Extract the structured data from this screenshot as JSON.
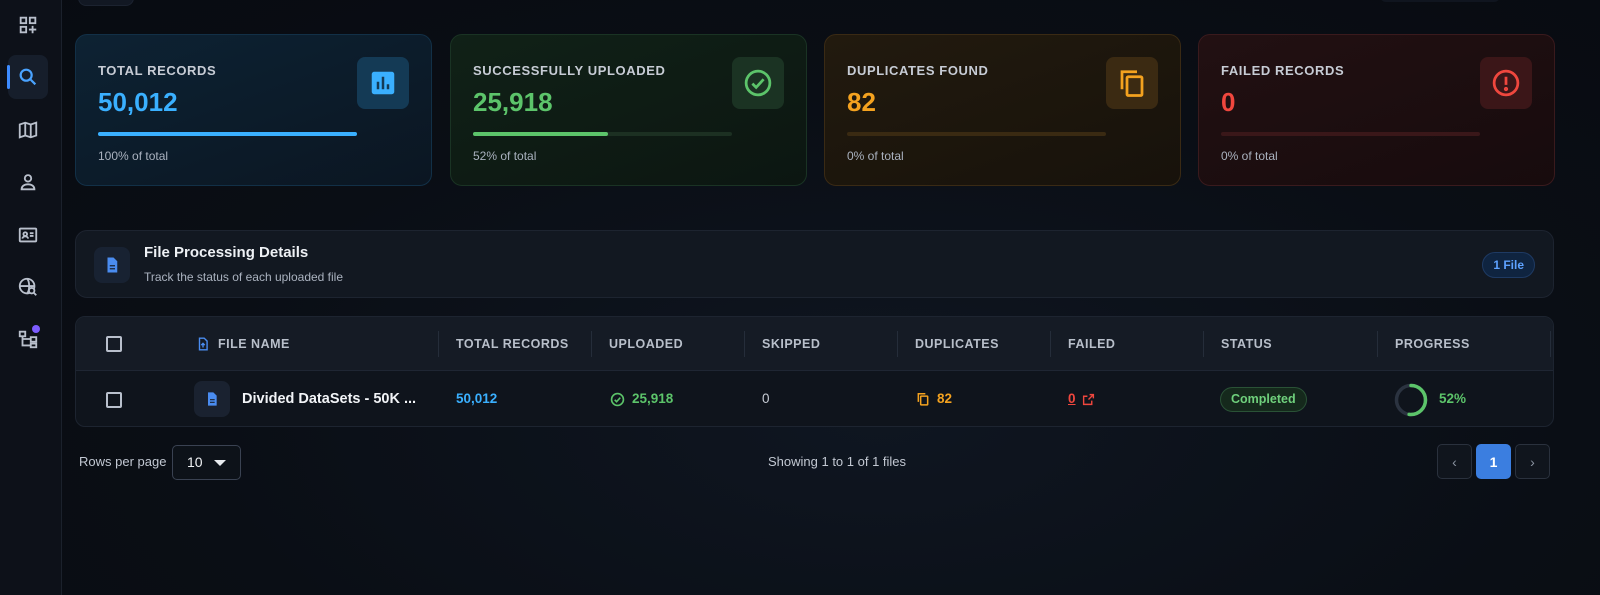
{
  "sidebar": {
    "items": [
      {
        "icon": "apps-add-icon",
        "active": false
      },
      {
        "icon": "search-icon",
        "active": true
      },
      {
        "icon": "map-icon",
        "active": false
      },
      {
        "icon": "user-icon",
        "active": false
      },
      {
        "icon": "id-card-icon",
        "active": false
      },
      {
        "icon": "globe-search-icon",
        "active": false
      },
      {
        "icon": "hierarchy-icon",
        "active": false,
        "badge": true
      }
    ]
  },
  "stats": {
    "total": {
      "label": "TOTAL RECORDS",
      "value": "50,012",
      "progress": 1.0,
      "sub": "100% of total",
      "icon": "bar-chart-icon",
      "color": "#3ab0ff"
    },
    "uploaded": {
      "label": "SUCCESSFULLY UPLOADED",
      "value": "25,918",
      "progress": 0.52,
      "sub": "52% of total",
      "icon": "check-circle-icon",
      "color": "#5cc46a"
    },
    "duplicates": {
      "label": "DUPLICATES FOUND",
      "value": "82",
      "progress": 0.0,
      "sub": "0% of total",
      "icon": "copy-icon",
      "color": "#f4a21f"
    },
    "failed": {
      "label": "FAILED RECORDS",
      "value": "0",
      "progress": 0.0,
      "sub": "0% of total",
      "icon": "alert-circle-icon",
      "color": "#f0473e"
    }
  },
  "section": {
    "title": "File Processing Details",
    "subtitle": "Track the status of each uploaded file",
    "count_badge": "1 File"
  },
  "table": {
    "columns": [
      "FILE NAME",
      "TOTAL RECORDS",
      "UPLOADED",
      "SKIPPED",
      "DUPLICATES",
      "FAILED",
      "STATUS",
      "PROGRESS"
    ],
    "rows": [
      {
        "file_name": "Divided DataSets - 50K ...",
        "total_records": "50,012",
        "uploaded": "25,918",
        "skipped": "0",
        "duplicates": "82",
        "failed": "0",
        "status": "Completed",
        "progress_label": "52%",
        "progress": 0.52
      }
    ]
  },
  "footer": {
    "rows_per_page_label": "Rows per page",
    "rows_per_page_value": "10",
    "showing": "Showing 1 to 1 of 1 files",
    "current_page": "1",
    "prev_label": "‹",
    "next_label": "›"
  }
}
